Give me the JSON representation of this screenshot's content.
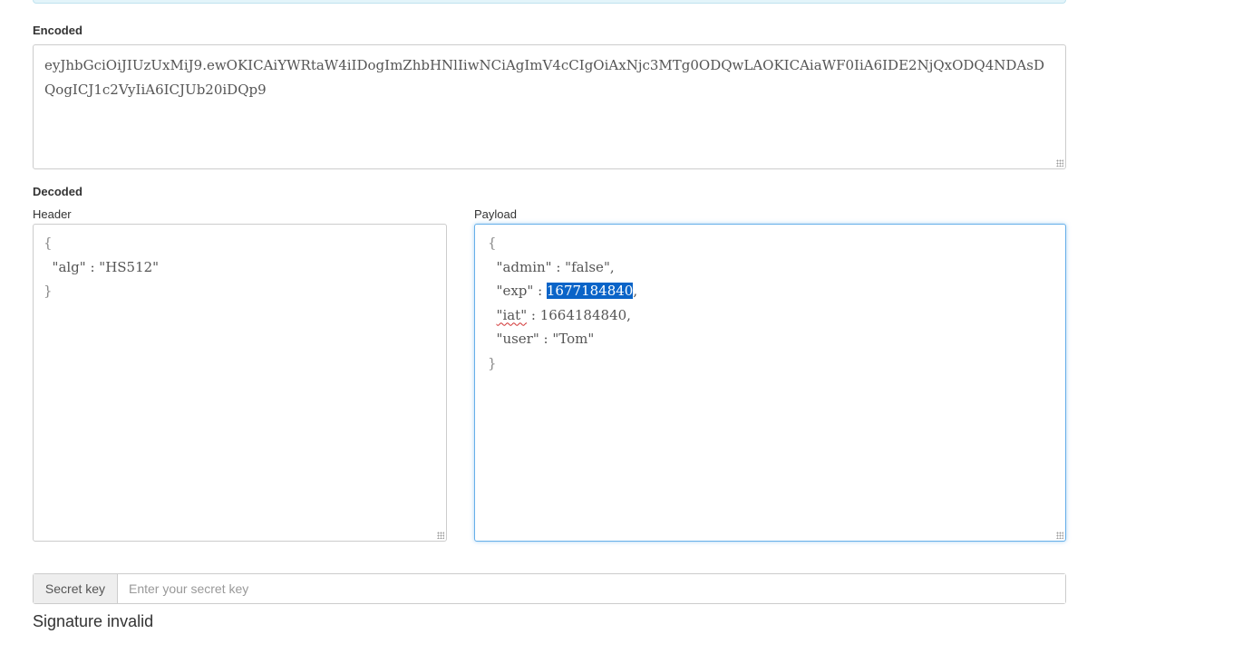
{
  "encoded": {
    "label": "Encoded",
    "token": "eyJhbGciOiJIUzUxMiJ9.ewOKICAiYWRtaW4iIDogImZhbHNlIiwNCiAgImV4cCIgOiAxNjc3MTg0ODQwLAOKICAiaWF0IiA6IDE2NjQxODQ4NDAsDQogICJ1c2VyIiA6ICJUb20iDQp9"
  },
  "decoded": {
    "label": "Decoded",
    "header": {
      "label": "Header",
      "open_brace": "{",
      "close_brace": "}",
      "lines": [
        {
          "key": "\"alg\"",
          "sep": " : ",
          "value": "\"HS512\"",
          "trail": ""
        }
      ]
    },
    "payload": {
      "label": "Payload",
      "open_brace": "{",
      "close_brace": "}",
      "lines": [
        {
          "key": "\"admin\"",
          "sep": " : ",
          "value": "\"false\"",
          "trail": ","
        },
        {
          "key": "\"exp\"",
          "sep": " : ",
          "value": "1677184840",
          "trail": ","
        },
        {
          "key": "\"iat\"",
          "sep": " : ",
          "value": "1664184840",
          "trail": ","
        },
        {
          "key": "\"user\"",
          "sep": " : ",
          "value": "\"Tom\"",
          "trail": ""
        }
      ]
    }
  },
  "secret": {
    "label": "Secret key",
    "placeholder": "Enter your secret key",
    "value": ""
  },
  "signature": {
    "status": "Signature invalid"
  },
  "colors": {
    "focus_border": "#66afe9",
    "selection": "#0a64c8"
  }
}
